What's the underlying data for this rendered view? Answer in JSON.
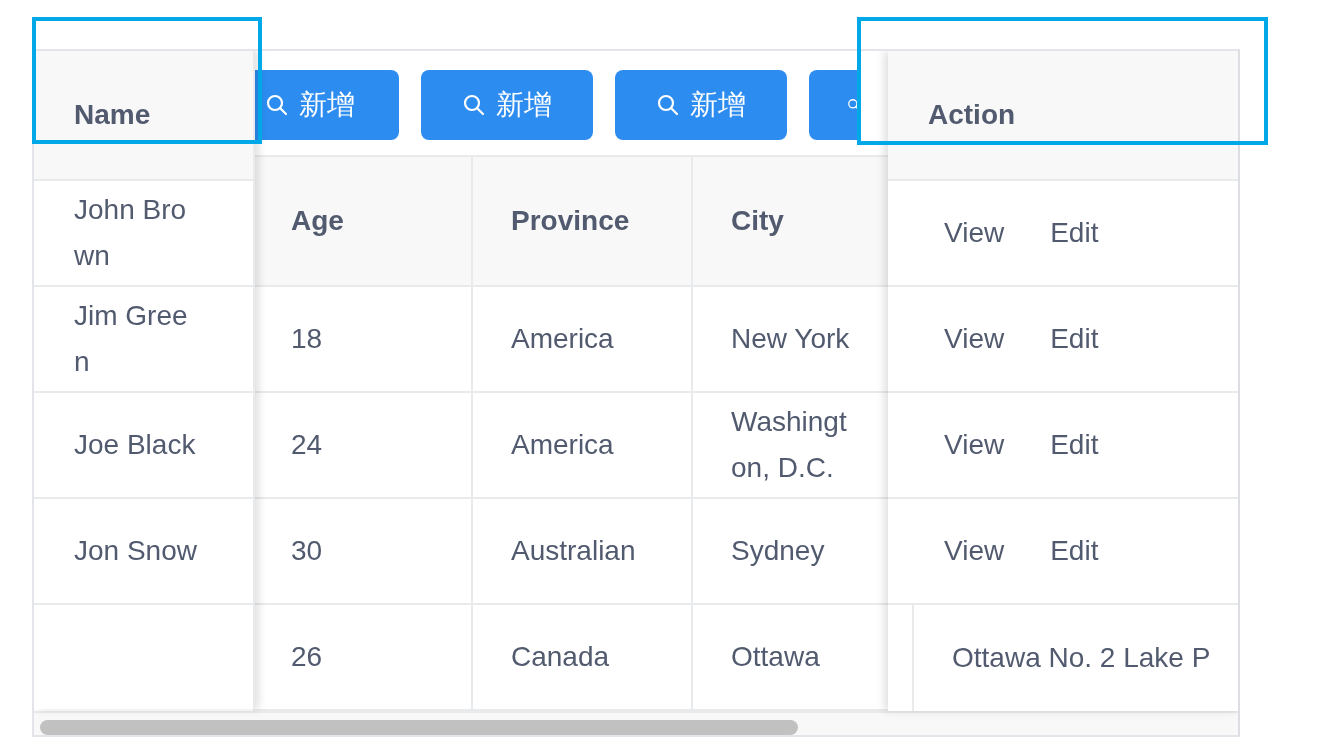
{
  "toolbar": {
    "buttons": [
      {
        "kind": "labeled",
        "label": "新增"
      },
      {
        "kind": "labeled",
        "label": "新增"
      },
      {
        "kind": "labeled",
        "label": "新增"
      },
      {
        "kind": "icon-only"
      }
    ]
  },
  "table": {
    "columns": [
      "Age",
      "Province",
      "City"
    ],
    "rows": [
      [
        "18",
        "America",
        "New York"
      ],
      [
        "24",
        "America",
        "Washington, D.C."
      ],
      [
        "30",
        "Australian",
        "Sydney"
      ],
      [
        "26",
        "Canada",
        "Ottawa"
      ]
    ]
  },
  "fixed_left": {
    "header": "Name",
    "rows": [
      "John Brown",
      "Jim Green",
      "Joe Black",
      "Jon Snow"
    ]
  },
  "fixed_right": {
    "header": "Action",
    "rows": [
      {
        "kind": "actions",
        "links": [
          "View",
          "Edit"
        ]
      },
      {
        "kind": "actions",
        "links": [
          "View",
          "Edit"
        ]
      },
      {
        "kind": "actions",
        "links": [
          "View",
          "Edit"
        ]
      },
      {
        "kind": "actions",
        "links": [
          "View",
          "Edit"
        ]
      },
      {
        "kind": "text",
        "text": "Ottawa No. 2 Lake P"
      }
    ]
  },
  "highlights": [
    {
      "kind": "frame"
    },
    {
      "kind": "frame"
    }
  ]
}
